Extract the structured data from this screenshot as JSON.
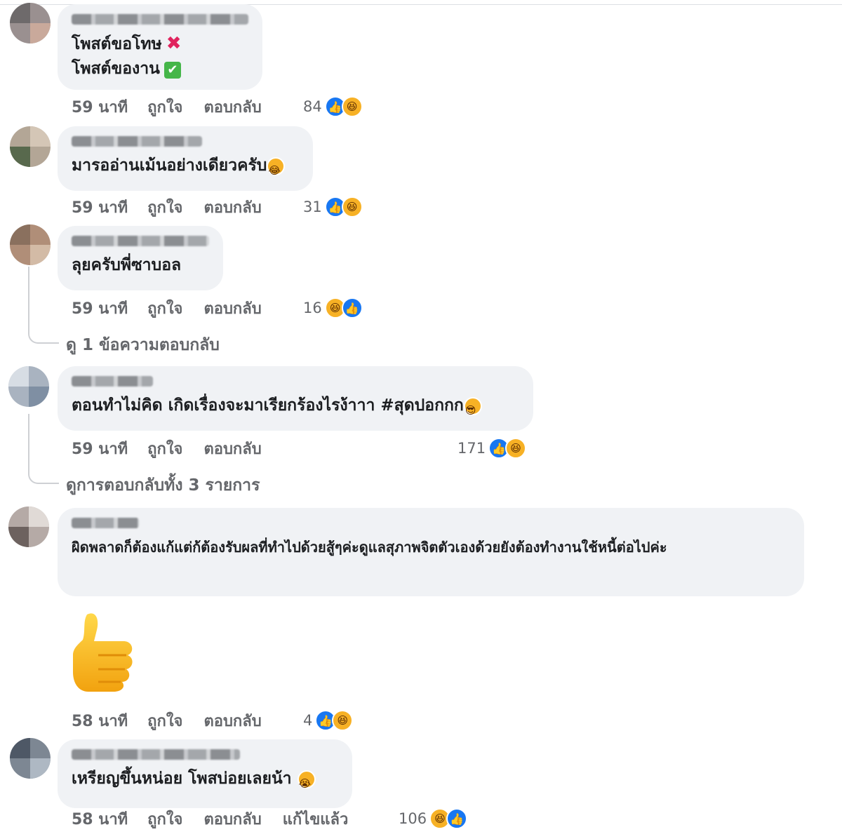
{
  "actions": {
    "like": "ถูกใจ",
    "reply": "ตอบกลับ"
  },
  "comments": [
    {
      "lines": [
        "โพสต์ขอโทษ",
        "โพสต์ของาน"
      ],
      "time": "59 นาที",
      "count": "84",
      "reactions": [
        "like-icon",
        "haha-icon"
      ]
    },
    {
      "text": "มารออ่านเม้นอย่างเดียวครับ",
      "time": "59 นาที",
      "count": "31",
      "reactions": [
        "like-icon",
        "haha-icon"
      ]
    },
    {
      "text": "ลุยครับพี่ซาบอล",
      "time": "59 นาที",
      "count": "16",
      "reactions": [
        "haha-icon",
        "like-icon"
      ],
      "view_replies": "ดู 1 ข้อความตอบกลับ"
    },
    {
      "text": "ตอนทำไม่คิด เกิดเรื่องจะมาเรียกร้องไรง้าาา #สุดปอกกก",
      "time": "59 นาที",
      "count": "171",
      "reactions": [
        "like-icon",
        "haha-icon"
      ],
      "view_replies": "ดูการตอบกลับทั้ง 3 รายการ"
    },
    {
      "text": "ผิดพลาดก็ต้องแก้แต่ก้ต้องรับผลที่ทำไปด้วยสู้ๆค่ะดูแลสุภาพจิตตัวเองด้วยยังต้องทำงานใช้หนี้ต่อไปค่ะ",
      "time": "58 นาที",
      "count": "4",
      "reactions": [
        "like-icon",
        "haha-icon"
      ],
      "sticker": "thumbs-up-icon"
    },
    {
      "text": "เหรียญขึ้นหน่อย โพสบ่อยเลยน้า",
      "time": "58 นาที",
      "count": "106",
      "reactions": [
        "haha-icon",
        "like-icon"
      ],
      "edited": "แก้ไขแล้ว"
    }
  ],
  "colors": {
    "bubble": "#f0f2f5",
    "like": "#1877f2",
    "haha": "#f7b125",
    "meta": "#65676b"
  }
}
